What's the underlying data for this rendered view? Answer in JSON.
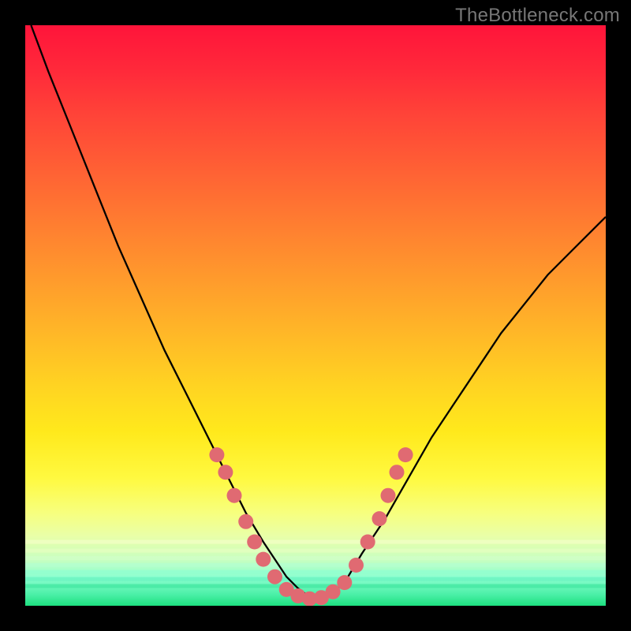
{
  "watermark": "TheBottleneck.com",
  "chart_data": {
    "type": "line",
    "title": "",
    "xlabel": "",
    "ylabel": "",
    "xlim": [
      0,
      100
    ],
    "ylim": [
      0,
      100
    ],
    "grid": false,
    "curve": {
      "x": [
        1,
        4,
        8,
        12,
        16,
        20,
        24,
        28,
        32,
        35,
        38,
        41,
        43,
        45,
        47,
        49,
        50,
        52,
        55,
        58,
        62,
        66,
        70,
        74,
        78,
        82,
        86,
        90,
        94,
        98,
        100
      ],
      "y": [
        100,
        92,
        82,
        72,
        62,
        53,
        44,
        36,
        28,
        22,
        16,
        11,
        8,
        5,
        3,
        1.5,
        1,
        1.5,
        4,
        9,
        15,
        22,
        29,
        35,
        41,
        47,
        52,
        57,
        61,
        65,
        67
      ]
    },
    "markers": [
      {
        "x": 33,
        "y": 26
      },
      {
        "x": 34.5,
        "y": 23
      },
      {
        "x": 36,
        "y": 19
      },
      {
        "x": 38,
        "y": 14.5
      },
      {
        "x": 39.5,
        "y": 11
      },
      {
        "x": 41,
        "y": 8
      },
      {
        "x": 43,
        "y": 5
      },
      {
        "x": 45,
        "y": 2.8
      },
      {
        "x": 47,
        "y": 1.7
      },
      {
        "x": 49,
        "y": 1.2
      },
      {
        "x": 51,
        "y": 1.4
      },
      {
        "x": 53,
        "y": 2.4
      },
      {
        "x": 55,
        "y": 4
      },
      {
        "x": 57,
        "y": 7
      },
      {
        "x": 59,
        "y": 11
      },
      {
        "x": 61,
        "y": 15
      },
      {
        "x": 62.5,
        "y": 19
      },
      {
        "x": 64,
        "y": 23
      },
      {
        "x": 65.5,
        "y": 26
      }
    ],
    "bands": [
      {
        "y": 11,
        "color": "#f4ffc8"
      },
      {
        "y": 9.5,
        "color": "#e6ffc0"
      },
      {
        "y": 8.2,
        "color": "#d0ffc8"
      },
      {
        "y": 7.0,
        "color": "#b4ffd0"
      },
      {
        "y": 5.8,
        "color": "#90ffd0"
      },
      {
        "y": 4.6,
        "color": "#68f2c0"
      },
      {
        "y": 3.4,
        "color": "#40e6a0"
      }
    ]
  }
}
